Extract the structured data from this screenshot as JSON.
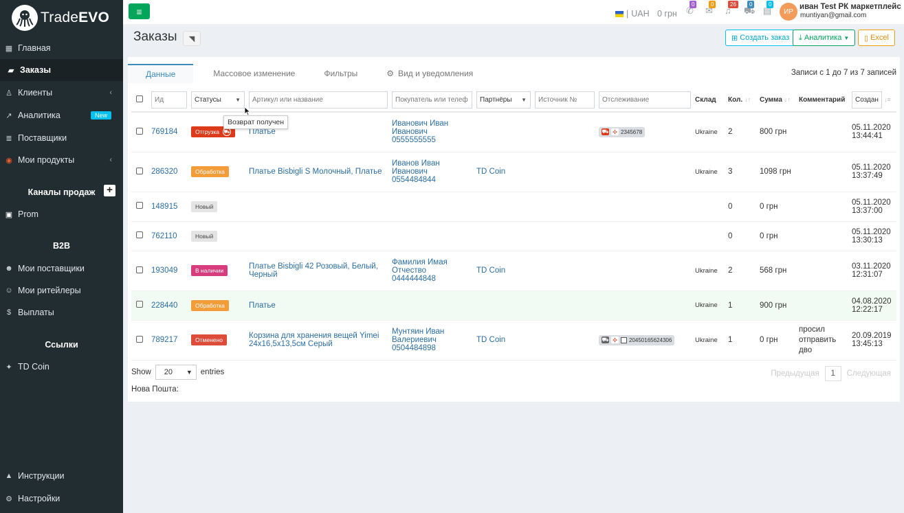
{
  "brand": {
    "name_prefix": "Trade",
    "name_suffix": "EVO"
  },
  "sidebar": {
    "items": [
      {
        "label": "Главная",
        "icon": "dashboard-icon"
      },
      {
        "label": "Заказы",
        "icon": "cart-icon"
      },
      {
        "label": "Клиенты",
        "icon": "user-icon",
        "chevron": "‹"
      },
      {
        "label": "Аналитика",
        "icon": "chart-icon",
        "badge": "New"
      },
      {
        "label": "Поставщики",
        "icon": "database-icon"
      },
      {
        "label": "Мои продукты",
        "icon": "product-icon",
        "chevron": "‹"
      }
    ],
    "channels_heading": "Каналы продаж",
    "channels_add": "+",
    "channels": [
      {
        "label": "Prom",
        "icon": "prom-icon"
      }
    ],
    "b2b_heading": "B2B",
    "b2b_items": [
      {
        "label": "Мои поставщики",
        "icon": "supplier-icon"
      },
      {
        "label": "Мои ритейлеры",
        "icon": "retailer-icon"
      },
      {
        "label": "Выплаты",
        "icon": "dollar-icon"
      }
    ],
    "links_heading": "Ссылки",
    "links": [
      {
        "label": "TD Coin",
        "icon": "pin-icon"
      }
    ],
    "bottom": [
      {
        "label": "Инструкции",
        "icon": "graduation-icon"
      },
      {
        "label": "Настройки",
        "icon": "gear-icon"
      }
    ]
  },
  "topbar": {
    "currency": "UAH",
    "separator": "|",
    "balance": "0 грн",
    "notifications": [
      {
        "icon": "phone-icon",
        "count": "0",
        "color": "#a25fd6"
      },
      {
        "icon": "chat-icon",
        "count": "0",
        "color": "#f39c12"
      },
      {
        "icon": "bell-icon",
        "count": "26",
        "color": "#dd4b39"
      },
      {
        "icon": "truck-icon",
        "count": "0",
        "color": "#3c8dbc"
      },
      {
        "icon": "basket-icon",
        "count": "0",
        "color": "#00c0ef"
      }
    ],
    "avatar_initials": "ИР",
    "user_name": "иван Test РК маркетплейс",
    "user_email": "muntiyan@gmail.com"
  },
  "page": {
    "title": "Заказы",
    "buttons": {
      "create": "Создать заказ",
      "analytics": "Аналитика",
      "excel": "Excel"
    }
  },
  "tabs": [
    {
      "label": "Данные"
    },
    {
      "label": "Массовое изменение"
    },
    {
      "label": "Фильтры"
    },
    {
      "label": "Вид и уведомления"
    }
  ],
  "records_info": "Записи с 1 до 7 из 7 записей",
  "table": {
    "headers": {
      "id": "Ид",
      "status": "Статусы",
      "article": "Артикул или название",
      "buyer": "Покупатель или телеф",
      "partners": "Партнёры",
      "source": "Источник №",
      "tracking": "Отслеживание",
      "warehouse": "Склад",
      "qty": "Кол.",
      "sum": "Сумма",
      "comment": "Комментарий",
      "created": "Создан"
    },
    "rows": [
      {
        "id": "769184",
        "status": "Отгрузка",
        "status_class": "st-ship",
        "article": "Платье",
        "buyer": [
          "Иванович Иван",
          "Иванович",
          "0555555555"
        ],
        "partner": "",
        "tracking": "2345678",
        "warehouse": "Ukraine",
        "qty": "2",
        "sum": "800 грн",
        "comment": "",
        "date": "05.11.2020",
        "time": "13:44:41"
      },
      {
        "id": "286320",
        "status": "Обработка",
        "status_class": "st-proc",
        "article": "Платье Bisbigli S Молочный, Платье",
        "buyer": [
          "Иванов Иван",
          "Иванович",
          "0554484844"
        ],
        "partner": "TD Coin",
        "tracking": "",
        "warehouse": "Ukraine",
        "qty": "3",
        "sum": "1098 грн",
        "comment": "",
        "date": "05.11.2020",
        "time": "13:37:49"
      },
      {
        "id": "148915",
        "status": "Новый",
        "status_class": "st-new",
        "article": "",
        "buyer": [],
        "partner": "",
        "tracking": "",
        "warehouse": "",
        "qty": "0",
        "sum": "0 грн",
        "comment": "",
        "date": "05.11.2020",
        "time": "13:37:00"
      },
      {
        "id": "762110",
        "status": "Новый",
        "status_class": "st-new",
        "article": "",
        "buyer": [],
        "partner": "",
        "tracking": "",
        "warehouse": "",
        "qty": "0",
        "sum": "0 грн",
        "comment": "",
        "date": "05.11.2020",
        "time": "13:30:13"
      },
      {
        "id": "193049",
        "status": "В наличии",
        "status_class": "st-stock",
        "article": "Платье Bisbigli 42 Розовый, Белый, Черный",
        "buyer": [
          "Фамилия Имая",
          "Отчество",
          "0444444848"
        ],
        "partner": "TD Coin",
        "tracking": "",
        "warehouse": "Ukraine",
        "qty": "2",
        "sum": "568 грн",
        "comment": "",
        "date": "03.11.2020",
        "time": "12:31:07"
      },
      {
        "id": "228440",
        "status": "Обработка",
        "status_class": "st-proc",
        "article": "Платье",
        "buyer": [],
        "partner": "",
        "tracking": "",
        "warehouse": "Ukraine",
        "qty": "1",
        "sum": "900 грн",
        "comment": "",
        "date": "04.08.2020",
        "time": "12:22:17"
      },
      {
        "id": "789217",
        "status": "Отменено",
        "status_class": "st-cancel",
        "article": "Корзина для хранения вещей Yimei 24х16,5х13,5см Серый",
        "buyer": [
          "Мунтяин Иван",
          "Валериевич",
          "0504484898"
        ],
        "partner": "TD Coin",
        "tracking": "20450165624306",
        "warehouse": "Ukraine",
        "qty": "1",
        "sum": "0 грн",
        "comment": "просил отправить дво",
        "date": "20.09.2019",
        "time": "13:45:13"
      }
    ]
  },
  "tooltip": "Возврат получен",
  "footer": {
    "show_label": "Show",
    "entries_value": "20",
    "entries_label": "entries",
    "nova": "Нова Пошта:",
    "prev": "Предыдущая",
    "page": "1",
    "next": "Следующая"
  }
}
